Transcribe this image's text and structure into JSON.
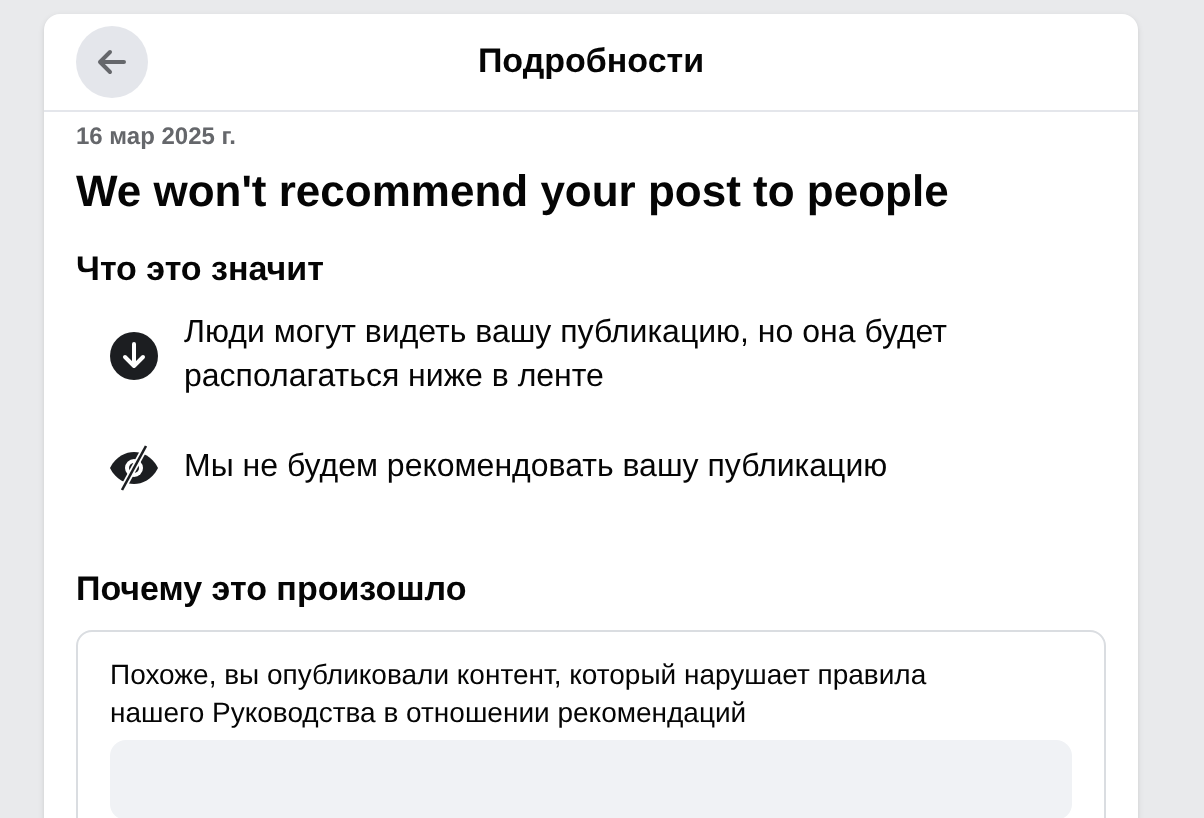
{
  "header": {
    "title": "Подробности"
  },
  "date": "16 мар 2025 г.",
  "headline": "We won't recommend your post to people",
  "meaning": {
    "heading": "Что это значит",
    "items": [
      {
        "kind": "down",
        "text": "Люди могут видеть вашу публикацию, но она будет располагаться ниже в ленте"
      },
      {
        "kind": "hidden",
        "text": "Мы не будем рекомендовать вашу публикацию"
      }
    ]
  },
  "reason": {
    "heading": "Почему это произошло",
    "text": "Похоже, вы опубликовали контент, который нарушает правила нашего Руководства в отношении рекомендаций"
  }
}
